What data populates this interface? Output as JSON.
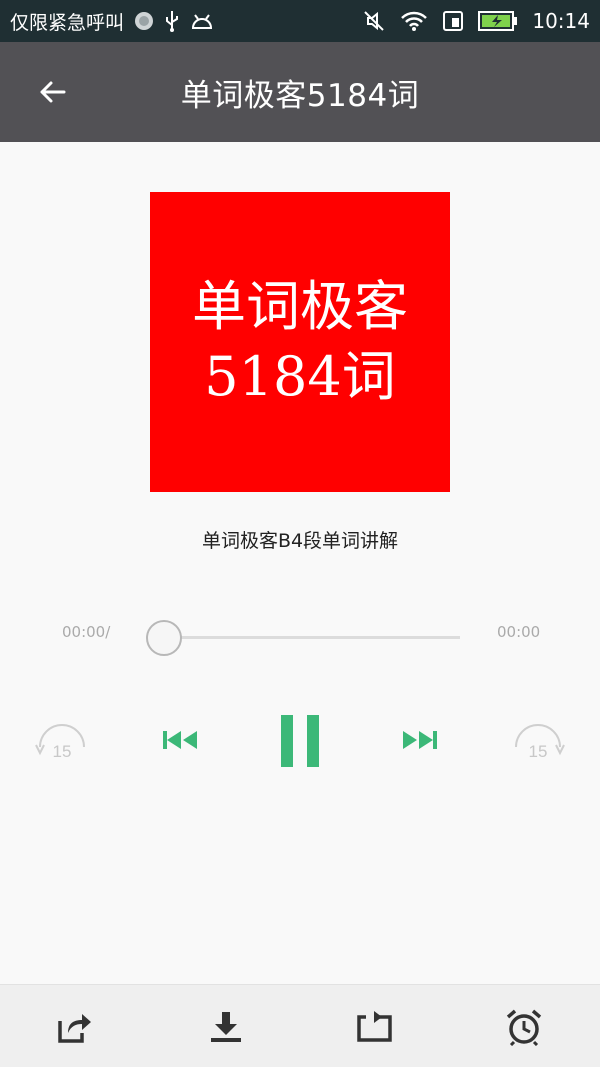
{
  "status_bar": {
    "carrier_text": "仅限紧急呼叫",
    "time": "10:14",
    "icons": [
      "record-icon",
      "usb-icon",
      "android-icon",
      "mute-icon",
      "wifi-icon",
      "sim-icon",
      "battery-charging-icon"
    ]
  },
  "app_bar": {
    "title": "单词极客5184词",
    "back_icon": "arrow-left-icon"
  },
  "cover": {
    "line1": "单词极客",
    "line2": "5184词",
    "background": "#ff0000"
  },
  "track": {
    "title": "单词极客B4段单词讲解"
  },
  "player": {
    "current_time": "00:00/",
    "total_time": "00:00",
    "progress": 0,
    "rewind_seconds": "15",
    "forward_seconds": "15",
    "accent_color": "#3cb878"
  },
  "bottom_bar": {
    "icons": [
      "share-icon",
      "download-icon",
      "repeat-icon",
      "alarm-clock-icon"
    ]
  }
}
